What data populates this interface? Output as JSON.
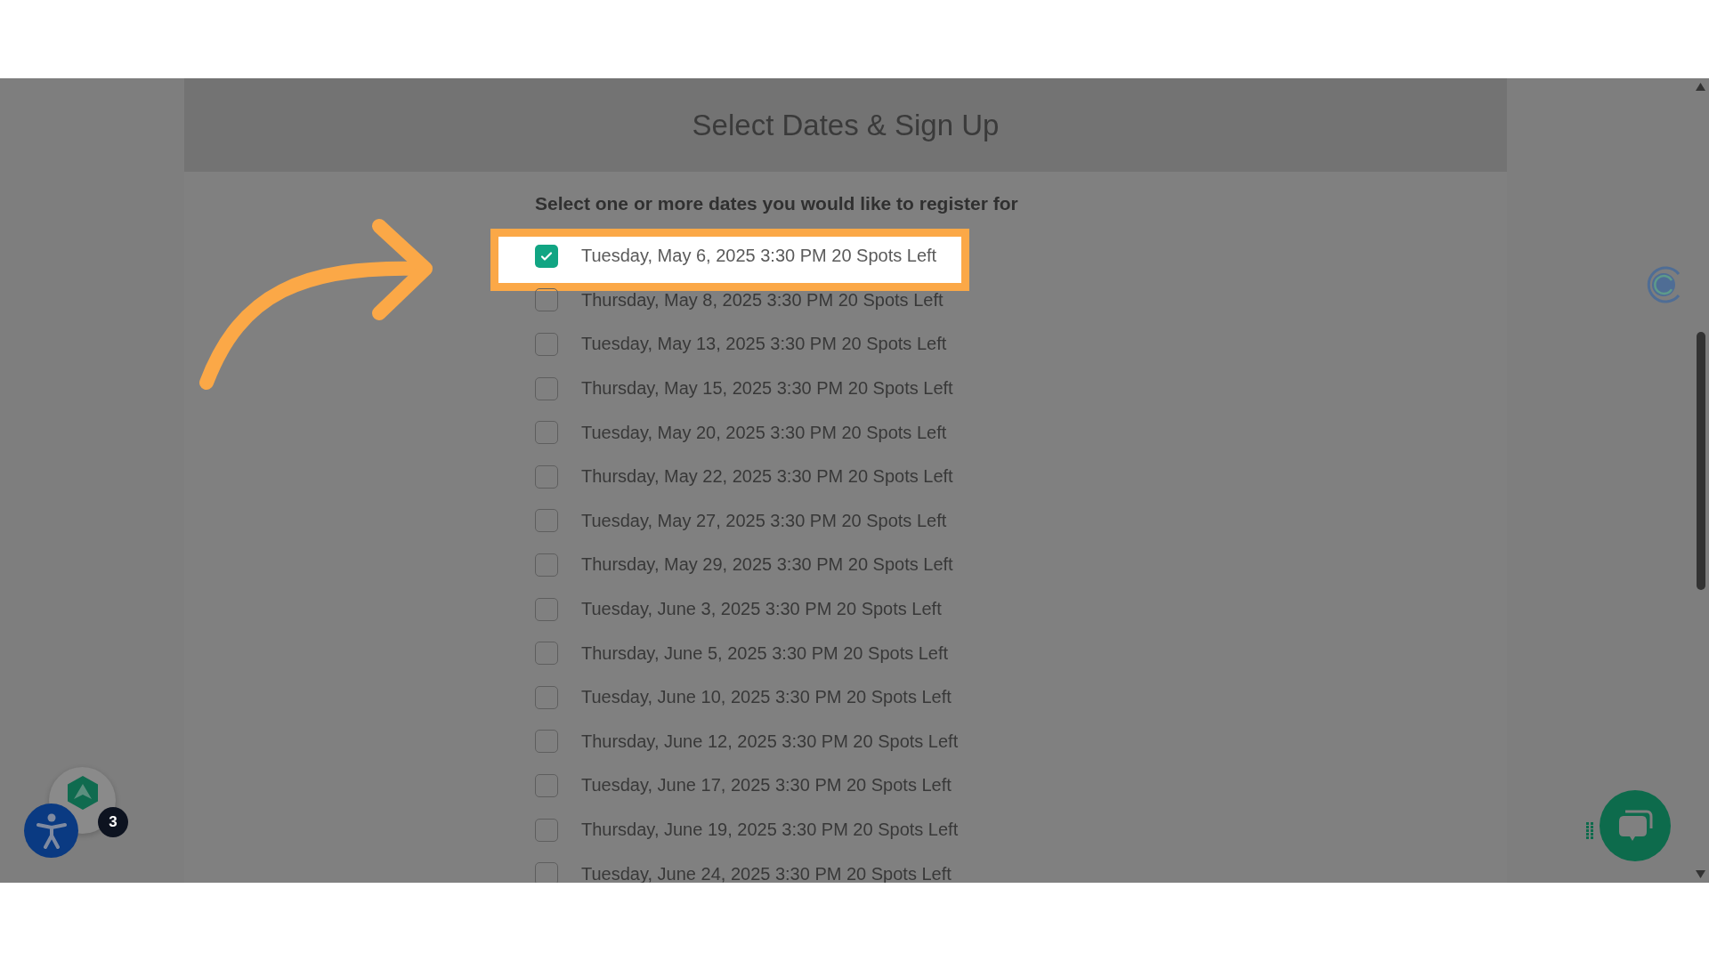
{
  "header": {
    "title": "Select Dates & Sign Up"
  },
  "form": {
    "prompt": "Select one or more dates you would like to register for",
    "dates": [
      {
        "label": "Tuesday, May 6, 2025 3:30 PM 20 Spots Left",
        "checked": true,
        "highlighted": true
      },
      {
        "label": "Thursday, May 8, 2025 3:30 PM 20 Spots Left",
        "checked": false,
        "highlighted": false
      },
      {
        "label": "Tuesday, May 13, 2025 3:30 PM 20 Spots Left",
        "checked": false,
        "highlighted": false
      },
      {
        "label": "Thursday, May 15, 2025 3:30 PM 20 Spots Left",
        "checked": false,
        "highlighted": false
      },
      {
        "label": "Tuesday, May 20, 2025 3:30 PM 20 Spots Left",
        "checked": false,
        "highlighted": false
      },
      {
        "label": "Thursday, May 22, 2025 3:30 PM 20 Spots Left",
        "checked": false,
        "highlighted": false
      },
      {
        "label": "Tuesday, May 27, 2025 3:30 PM 20 Spots Left",
        "checked": false,
        "highlighted": false
      },
      {
        "label": "Thursday, May 29, 2025 3:30 PM 20 Spots Left",
        "checked": false,
        "highlighted": false
      },
      {
        "label": "Tuesday, June 3, 2025 3:30 PM 20 Spots Left",
        "checked": false,
        "highlighted": false
      },
      {
        "label": "Thursday, June 5, 2025 3:30 PM 20 Spots Left",
        "checked": false,
        "highlighted": false
      },
      {
        "label": "Tuesday, June 10, 2025 3:30 PM 20 Spots Left",
        "checked": false,
        "highlighted": false
      },
      {
        "label": "Thursday, June 12, 2025 3:30 PM 20 Spots Left",
        "checked": false,
        "highlighted": false
      },
      {
        "label": "Tuesday, June 17, 2025 3:30 PM 20 Spots Left",
        "checked": false,
        "highlighted": false
      },
      {
        "label": "Thursday, June 19, 2025 3:30 PM 20 Spots Left",
        "checked": false,
        "highlighted": false
      },
      {
        "label": "Tuesday, June 24, 2025 3:30 PM 20 Spots Left",
        "checked": false,
        "highlighted": false
      }
    ]
  },
  "widgets": {
    "notification_count": "3"
  }
}
